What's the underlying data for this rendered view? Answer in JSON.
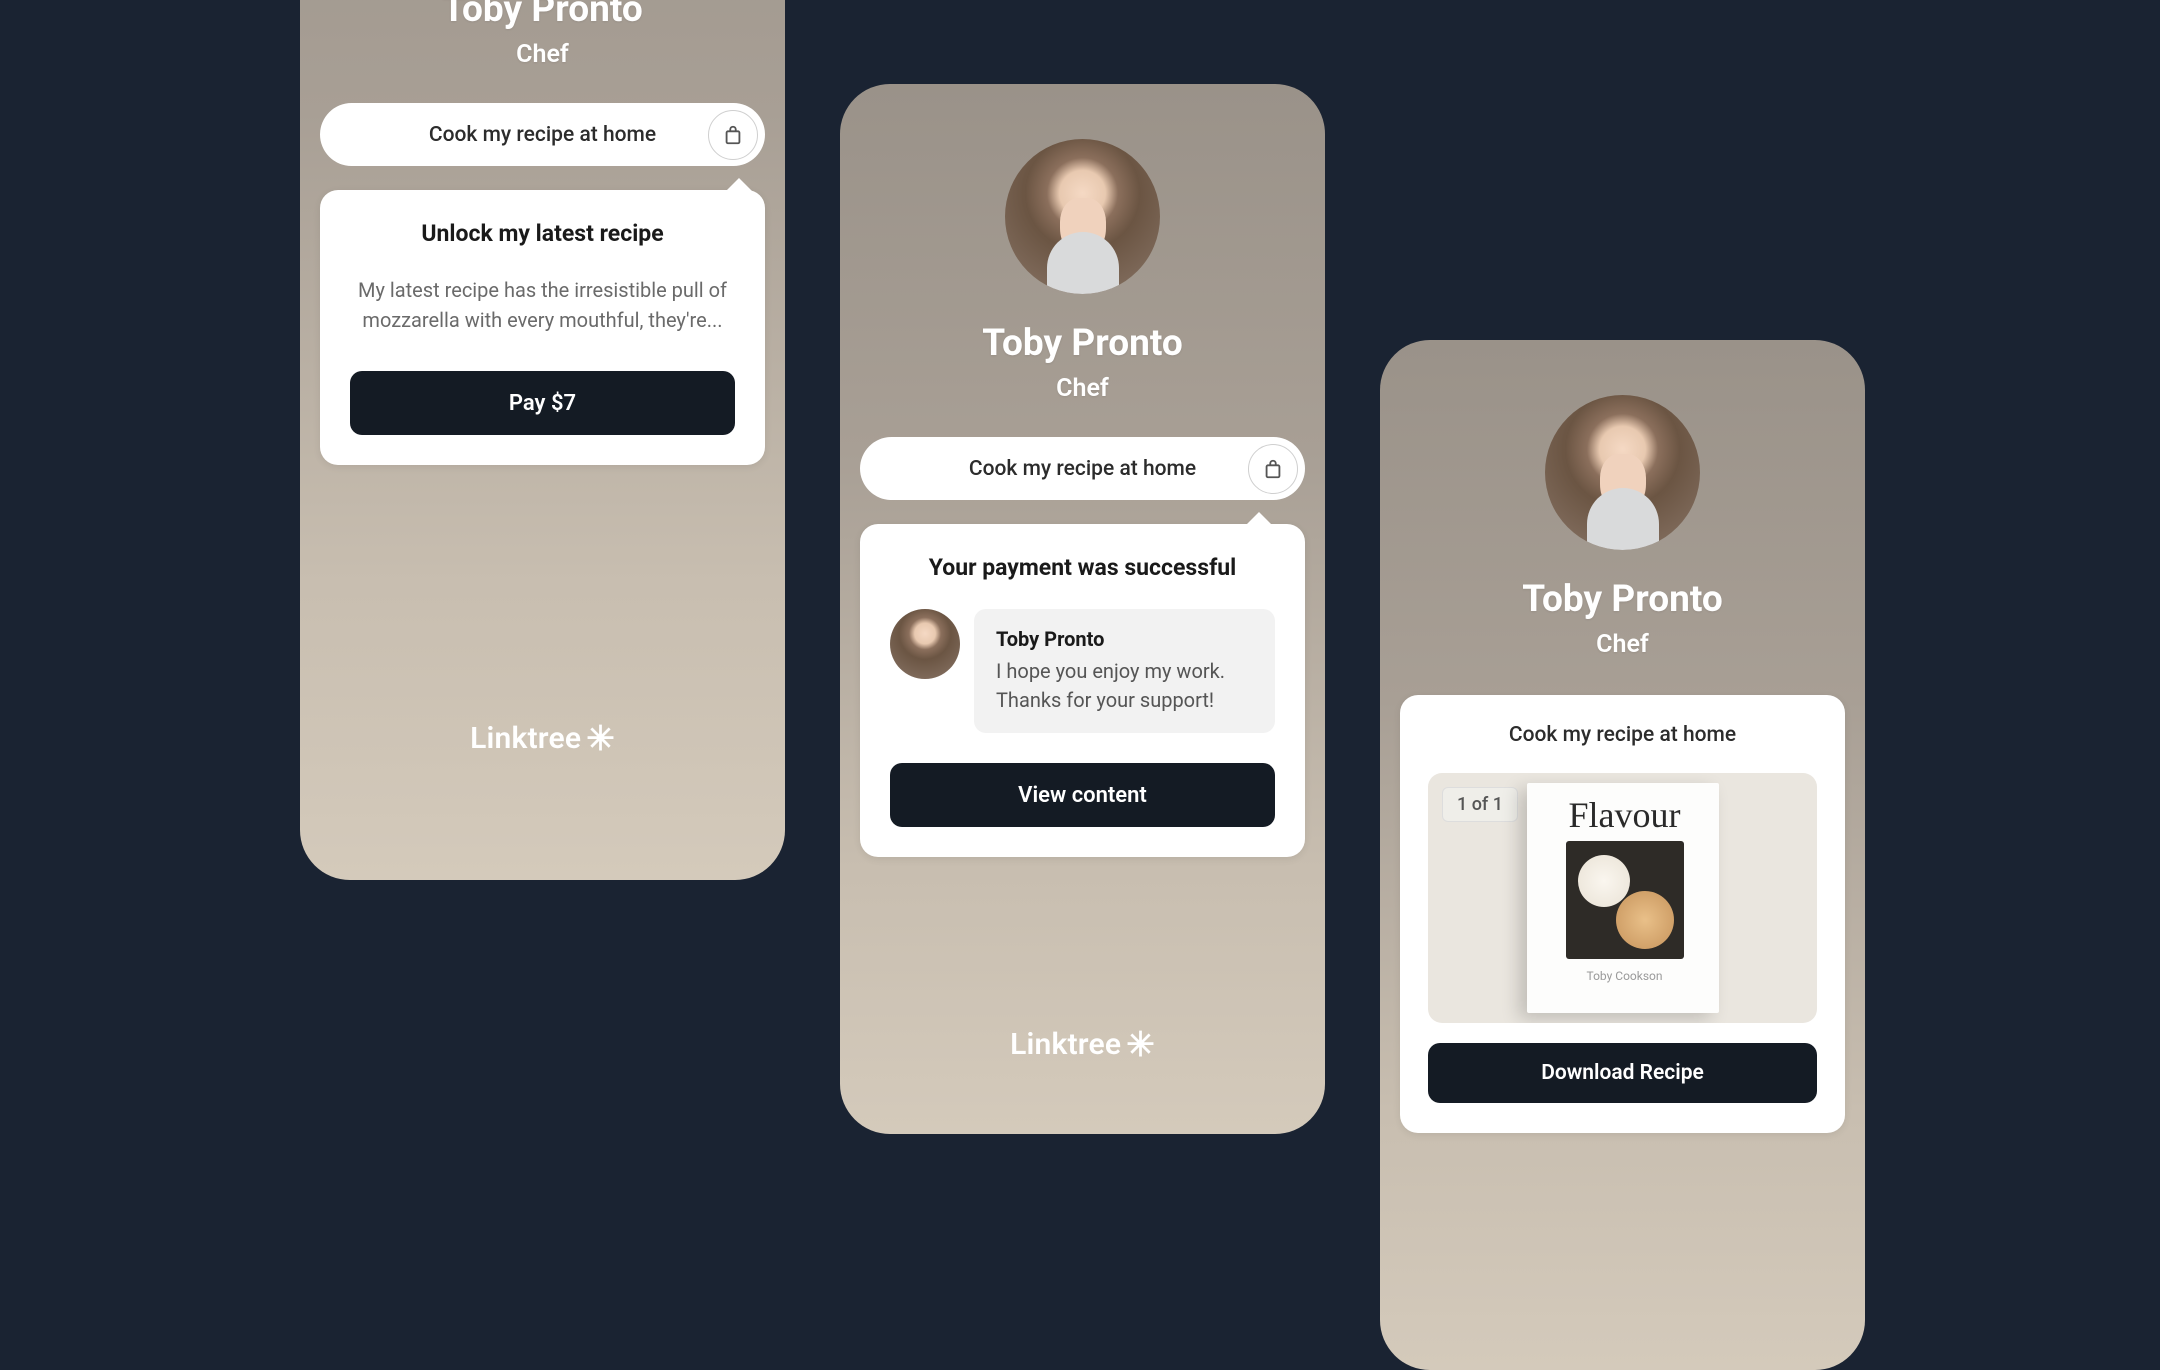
{
  "profile": {
    "name": "Toby Pronto",
    "role": "Chef",
    "link_label": "Cook my recipe at home"
  },
  "screen1": {
    "popover_title": "Unlock my latest recipe",
    "popover_desc": "My latest recipe has the irresistible pull of mozzarella with every mouthful, they're...",
    "cta": "Pay $7"
  },
  "screen2": {
    "popover_title": "Your payment was successful",
    "sender": "Toby Pronto",
    "message": "I hope you enjoy my work. Thanks for your support!",
    "cta": "View content"
  },
  "screen3": {
    "card_title": "Cook my recipe at home",
    "page_badge": "1 of 1",
    "book_title": "Flavour",
    "book_author": "Toby Cookson",
    "cta": "Download Recipe"
  },
  "brand": "Linktree"
}
